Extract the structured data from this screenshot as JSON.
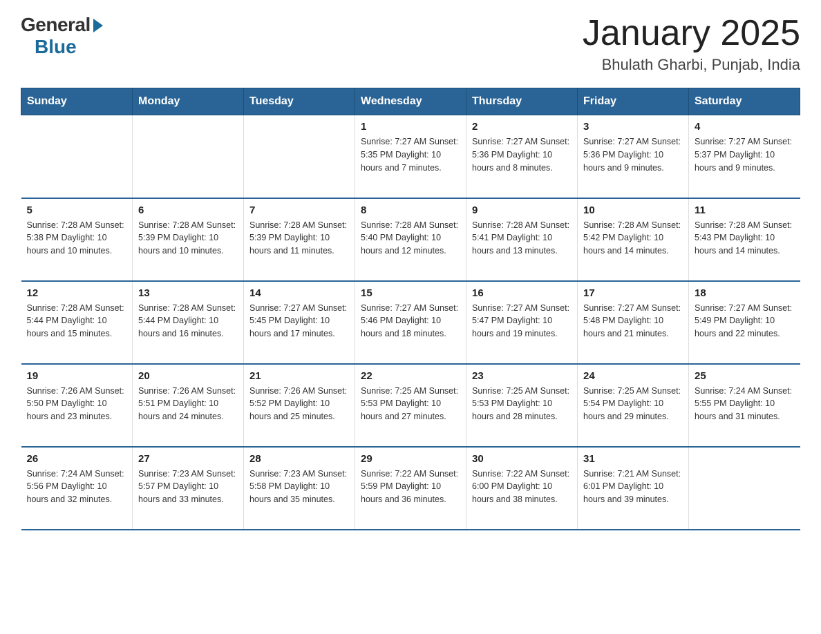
{
  "header": {
    "logo_general": "General",
    "logo_blue": "Blue",
    "month_title": "January 2025",
    "location": "Bhulath Gharbi, Punjab, India"
  },
  "days_of_week": [
    "Sunday",
    "Monday",
    "Tuesday",
    "Wednesday",
    "Thursday",
    "Friday",
    "Saturday"
  ],
  "weeks": [
    [
      {
        "day": "",
        "info": ""
      },
      {
        "day": "",
        "info": ""
      },
      {
        "day": "",
        "info": ""
      },
      {
        "day": "1",
        "info": "Sunrise: 7:27 AM\nSunset: 5:35 PM\nDaylight: 10 hours and 7 minutes."
      },
      {
        "day": "2",
        "info": "Sunrise: 7:27 AM\nSunset: 5:36 PM\nDaylight: 10 hours and 8 minutes."
      },
      {
        "day": "3",
        "info": "Sunrise: 7:27 AM\nSunset: 5:36 PM\nDaylight: 10 hours and 9 minutes."
      },
      {
        "day": "4",
        "info": "Sunrise: 7:27 AM\nSunset: 5:37 PM\nDaylight: 10 hours and 9 minutes."
      }
    ],
    [
      {
        "day": "5",
        "info": "Sunrise: 7:28 AM\nSunset: 5:38 PM\nDaylight: 10 hours and 10 minutes."
      },
      {
        "day": "6",
        "info": "Sunrise: 7:28 AM\nSunset: 5:39 PM\nDaylight: 10 hours and 10 minutes."
      },
      {
        "day": "7",
        "info": "Sunrise: 7:28 AM\nSunset: 5:39 PM\nDaylight: 10 hours and 11 minutes."
      },
      {
        "day": "8",
        "info": "Sunrise: 7:28 AM\nSunset: 5:40 PM\nDaylight: 10 hours and 12 minutes."
      },
      {
        "day": "9",
        "info": "Sunrise: 7:28 AM\nSunset: 5:41 PM\nDaylight: 10 hours and 13 minutes."
      },
      {
        "day": "10",
        "info": "Sunrise: 7:28 AM\nSunset: 5:42 PM\nDaylight: 10 hours and 14 minutes."
      },
      {
        "day": "11",
        "info": "Sunrise: 7:28 AM\nSunset: 5:43 PM\nDaylight: 10 hours and 14 minutes."
      }
    ],
    [
      {
        "day": "12",
        "info": "Sunrise: 7:28 AM\nSunset: 5:44 PM\nDaylight: 10 hours and 15 minutes."
      },
      {
        "day": "13",
        "info": "Sunrise: 7:28 AM\nSunset: 5:44 PM\nDaylight: 10 hours and 16 minutes."
      },
      {
        "day": "14",
        "info": "Sunrise: 7:27 AM\nSunset: 5:45 PM\nDaylight: 10 hours and 17 minutes."
      },
      {
        "day": "15",
        "info": "Sunrise: 7:27 AM\nSunset: 5:46 PM\nDaylight: 10 hours and 18 minutes."
      },
      {
        "day": "16",
        "info": "Sunrise: 7:27 AM\nSunset: 5:47 PM\nDaylight: 10 hours and 19 minutes."
      },
      {
        "day": "17",
        "info": "Sunrise: 7:27 AM\nSunset: 5:48 PM\nDaylight: 10 hours and 21 minutes."
      },
      {
        "day": "18",
        "info": "Sunrise: 7:27 AM\nSunset: 5:49 PM\nDaylight: 10 hours and 22 minutes."
      }
    ],
    [
      {
        "day": "19",
        "info": "Sunrise: 7:26 AM\nSunset: 5:50 PM\nDaylight: 10 hours and 23 minutes."
      },
      {
        "day": "20",
        "info": "Sunrise: 7:26 AM\nSunset: 5:51 PM\nDaylight: 10 hours and 24 minutes."
      },
      {
        "day": "21",
        "info": "Sunrise: 7:26 AM\nSunset: 5:52 PM\nDaylight: 10 hours and 25 minutes."
      },
      {
        "day": "22",
        "info": "Sunrise: 7:25 AM\nSunset: 5:53 PM\nDaylight: 10 hours and 27 minutes."
      },
      {
        "day": "23",
        "info": "Sunrise: 7:25 AM\nSunset: 5:53 PM\nDaylight: 10 hours and 28 minutes."
      },
      {
        "day": "24",
        "info": "Sunrise: 7:25 AM\nSunset: 5:54 PM\nDaylight: 10 hours and 29 minutes."
      },
      {
        "day": "25",
        "info": "Sunrise: 7:24 AM\nSunset: 5:55 PM\nDaylight: 10 hours and 31 minutes."
      }
    ],
    [
      {
        "day": "26",
        "info": "Sunrise: 7:24 AM\nSunset: 5:56 PM\nDaylight: 10 hours and 32 minutes."
      },
      {
        "day": "27",
        "info": "Sunrise: 7:23 AM\nSunset: 5:57 PM\nDaylight: 10 hours and 33 minutes."
      },
      {
        "day": "28",
        "info": "Sunrise: 7:23 AM\nSunset: 5:58 PM\nDaylight: 10 hours and 35 minutes."
      },
      {
        "day": "29",
        "info": "Sunrise: 7:22 AM\nSunset: 5:59 PM\nDaylight: 10 hours and 36 minutes."
      },
      {
        "day": "30",
        "info": "Sunrise: 7:22 AM\nSunset: 6:00 PM\nDaylight: 10 hours and 38 minutes."
      },
      {
        "day": "31",
        "info": "Sunrise: 7:21 AM\nSunset: 6:01 PM\nDaylight: 10 hours and 39 minutes."
      },
      {
        "day": "",
        "info": ""
      }
    ]
  ]
}
